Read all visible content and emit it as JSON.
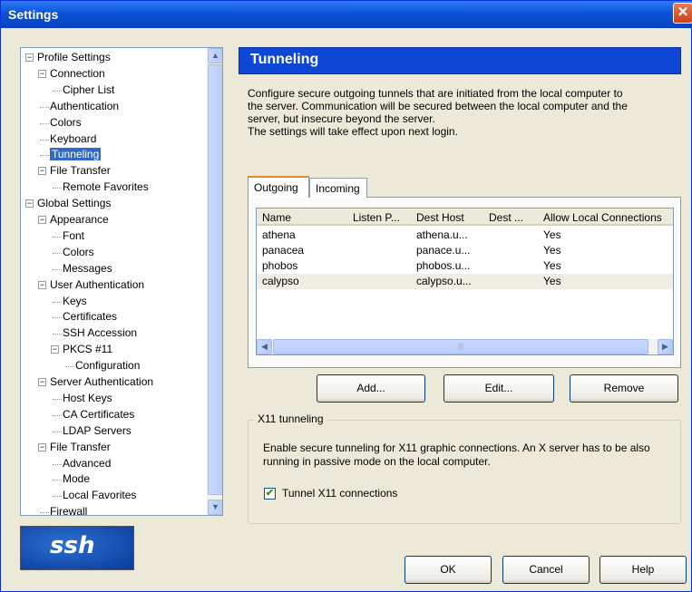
{
  "window": {
    "title": "Settings",
    "close_glyph": "✕"
  },
  "tree": {
    "items": [
      {
        "label": "Profile Settings",
        "exp": "−"
      },
      {
        "label": "Connection",
        "exp": "−"
      },
      {
        "label": "Cipher List"
      },
      {
        "label": "Authentication"
      },
      {
        "label": "Colors"
      },
      {
        "label": "Keyboard"
      },
      {
        "label": "Tunneling",
        "selected": true
      },
      {
        "label": "File Transfer",
        "exp": "−"
      },
      {
        "label": "Remote Favorites"
      },
      {
        "label": "Global Settings",
        "exp": "−"
      },
      {
        "label": "Appearance",
        "exp": "−"
      },
      {
        "label": "Font"
      },
      {
        "label": "Colors"
      },
      {
        "label": "Messages"
      },
      {
        "label": "User Authentication",
        "exp": "−"
      },
      {
        "label": "Keys"
      },
      {
        "label": "Certificates"
      },
      {
        "label": "SSH Accession"
      },
      {
        "label": "PKCS #11",
        "exp": "−"
      },
      {
        "label": "Configuration"
      },
      {
        "label": "Server Authentication",
        "exp": "−"
      },
      {
        "label": "Host Keys"
      },
      {
        "label": "CA Certificates"
      },
      {
        "label": "LDAP Servers"
      },
      {
        "label": "File Transfer",
        "exp": "−"
      },
      {
        "label": "Advanced"
      },
      {
        "label": "Mode"
      },
      {
        "label": "Local Favorites"
      },
      {
        "label": "Firewall"
      }
    ],
    "scroll_up": "▲",
    "scroll_down": "▼"
  },
  "logo": {
    "text": "ssh"
  },
  "panel": {
    "title": "Tunneling",
    "description": [
      "Configure secure outgoing tunnels that are initiated from the local computer to",
      "the server. Communication will be secured between the local computer and the",
      "server, but insecure beyond the server.",
      "The settings will take effect upon next login."
    ]
  },
  "tabs": {
    "outgoing": "Outgoing",
    "incoming": "Incoming"
  },
  "table": {
    "columns": [
      "Name",
      "Listen P...",
      "Dest Host",
      "Dest ...",
      "Allow Local Connections"
    ],
    "rows": [
      {
        "name": "athena",
        "listen": "",
        "dest_host": "athena.u...",
        "dest_port": "",
        "allow": "Yes"
      },
      {
        "name": "panacea",
        "listen": "",
        "dest_host": "panace.u...",
        "dest_port": "",
        "allow": "Yes"
      },
      {
        "name": "phobos",
        "listen": "",
        "dest_host": "phobos.u...",
        "dest_port": "",
        "allow": "Yes"
      },
      {
        "name": "calypso",
        "listen": "",
        "dest_host": "calypso.u...",
        "dest_port": "",
        "allow": "Yes",
        "selected": true
      }
    ],
    "scroll_left": "◀",
    "scroll_right": "▶",
    "grip": "|||"
  },
  "buttons": {
    "add": "Add...",
    "edit": "Edit...",
    "remove": "Remove",
    "ok": "OK",
    "cancel": "Cancel",
    "help": "Help"
  },
  "x11": {
    "legend": "X11 tunneling",
    "text": "Enable secure tunneling for X11 graphic connections. An X server has to be also running in passive mode on the local computer.",
    "checkbox_label": "Tunnel X11 connections",
    "checked_glyph": "✔"
  }
}
